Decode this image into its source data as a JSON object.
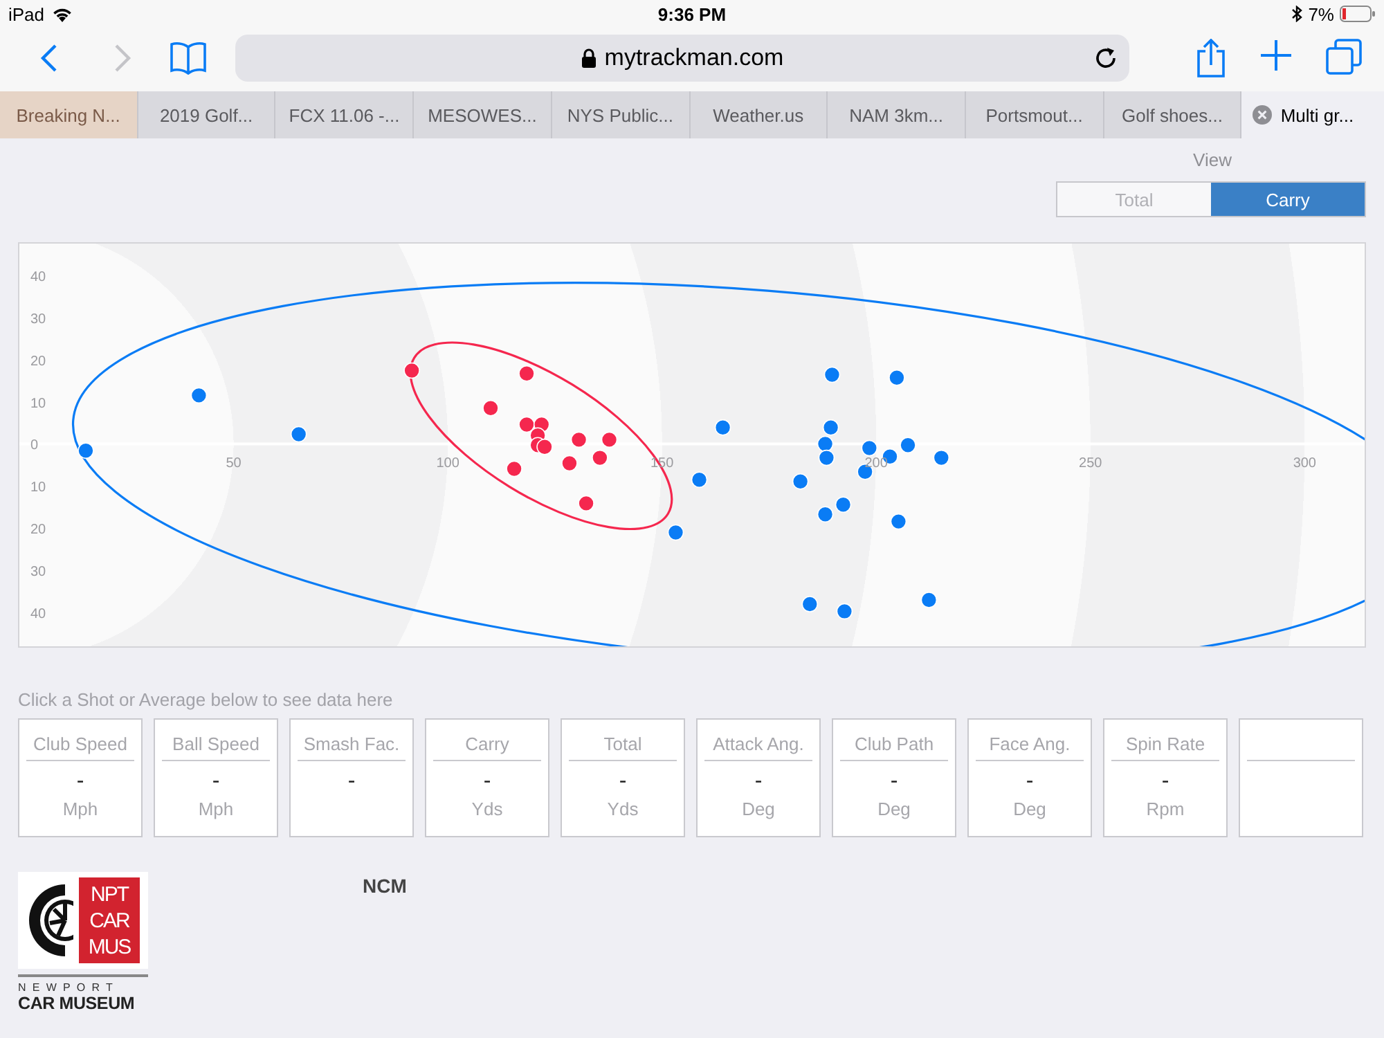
{
  "status_bar": {
    "device": "iPad",
    "time": "9:36 PM",
    "battery": "7%"
  },
  "toolbar": {
    "address": "mytrackman.com",
    "back_enabled": true,
    "forward_enabled": false
  },
  "tabs": [
    {
      "label": "Breaking N...",
      "selected": false
    },
    {
      "label": "2019 Golf...",
      "selected": false
    },
    {
      "label": "FCX 11.06 -...",
      "selected": false
    },
    {
      "label": "MESOWES...",
      "selected": false
    },
    {
      "label": "NYS Public...",
      "selected": false
    },
    {
      "label": "Weather.us",
      "selected": false
    },
    {
      "label": "NAM 3km...",
      "selected": false
    },
    {
      "label": "Portsmout...",
      "selected": false
    },
    {
      "label": "Golf shoes...",
      "selected": false
    },
    {
      "label": "Multi gr...",
      "selected": true
    }
  ],
  "view": {
    "label": "View",
    "options": [
      {
        "label": "Total",
        "selected": false
      },
      {
        "label": "Carry",
        "selected": true
      }
    ]
  },
  "chart_data": {
    "type": "scatter",
    "xlim": [
      0,
      314
    ],
    "ylim": [
      -48,
      47.5
    ],
    "xticks": [
      50,
      100,
      150,
      200,
      250,
      300
    ],
    "yticks": [
      {
        "value": 40,
        "label": "40"
      },
      {
        "value": 30,
        "label": "30"
      },
      {
        "value": 20,
        "label": "20"
      },
      {
        "value": 10,
        "label": "10"
      },
      {
        "value": 0,
        "label": "0"
      },
      {
        "value": -10,
        "label": "10"
      },
      {
        "value": -20,
        "label": "20"
      },
      {
        "value": -30,
        "label": "30"
      },
      {
        "value": -40,
        "label": "40"
      }
    ],
    "series": [
      {
        "color": "#0a7cf5",
        "x": [
          15.5,
          41.9,
          65.2,
          153.2,
          158.7,
          164.2,
          182.3,
          184.5,
          189.7,
          189.4,
          188.1,
          188.4,
          188.1,
          192.6,
          192.3,
          198.4,
          197.4,
          203.2,
          204.8,
          205.2,
          207.4,
          212.3,
          215.2
        ],
        "values": [
          -1.6,
          11.5,
          2.3,
          -21,
          -8.5,
          3.9,
          -8.9,
          -38,
          16.4,
          3.9,
          0,
          -3.3,
          -16.7,
          -39.7,
          -14.4,
          -1,
          -6.6,
          -3,
          15.7,
          -18.4,
          -0.3,
          -37,
          -3.3
        ]
      },
      {
        "color": "#f5274e",
        "x": [
          91.6,
          118.4,
          110,
          118.4,
          121.9,
          121,
          121,
          122.6,
          130.6,
          115.5,
          128.4,
          135.5,
          137.7,
          132.3
        ],
        "values": [
          17.4,
          16.7,
          8.5,
          4.6,
          4.6,
          2,
          -0.3,
          -0.7,
          1,
          -5.9,
          -4.6,
          -3.3,
          1,
          -14.1
        ]
      }
    ]
  },
  "hint": "Click a Shot or Average below to see data here",
  "cards": [
    {
      "kind": "stat",
      "label": "Club Speed",
      "value": "-",
      "unit": "Mph"
    },
    {
      "kind": "stat",
      "label": "Ball Speed",
      "value": "-",
      "unit": "Mph"
    },
    {
      "kind": "stat",
      "label": "Smash Fac.",
      "value": "-"
    },
    {
      "kind": "stat",
      "label": "Carry",
      "value": "-",
      "unit": "Yds"
    },
    {
      "kind": "stat",
      "label": "Total",
      "value": "-",
      "unit": "Yds"
    },
    {
      "kind": "stat",
      "label": "Attack Ang.",
      "value": "-",
      "unit": "Deg"
    },
    {
      "kind": "stat",
      "label": "Club Path",
      "value": "-",
      "unit": "Deg"
    },
    {
      "kind": "stat",
      "label": "Face Ang.",
      "value": "-",
      "unit": "Deg"
    },
    {
      "kind": "stat",
      "label": "Spin Rate",
      "value": "-",
      "unit": "Rpm"
    },
    {
      "kind": "blank"
    }
  ],
  "logo": {
    "badge_lines": [
      "NPT",
      "CAR",
      "MUS"
    ],
    "top_line": "NEWPORT",
    "bottom_line": "CAR MUSEUM"
  },
  "club_name": "NCM"
}
